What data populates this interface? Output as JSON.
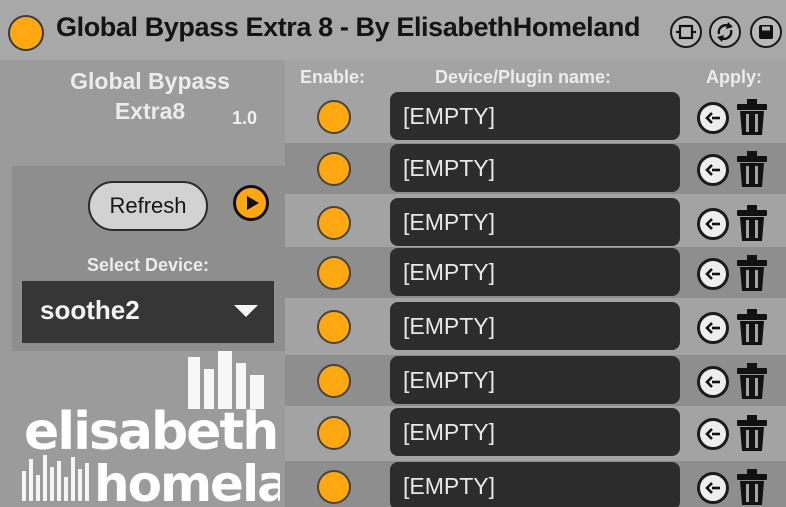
{
  "window": {
    "title": "Global Bypass Extra 8 - By ElisabethHomeland",
    "icons": [
      "pin-icon",
      "refresh-cycle-icon",
      "save-icon"
    ]
  },
  "left": {
    "title": "Global Bypass Extra8",
    "version": "1.0",
    "refresh_label": "Refresh",
    "select_label": "Select Device:",
    "selected_device": "soothe2",
    "logo_text": [
      "elisabeth",
      "homeland"
    ]
  },
  "headers": {
    "enable": "Enable:",
    "device_name": "Device/Plugin name:",
    "apply": "Apply:"
  },
  "rows": [
    {
      "enabled": true,
      "name": "[EMPTY]"
    },
    {
      "enabled": true,
      "name": "[EMPTY]"
    },
    {
      "enabled": true,
      "name": "[EMPTY]"
    },
    {
      "enabled": true,
      "name": "[EMPTY]"
    },
    {
      "enabled": true,
      "name": "[EMPTY]"
    },
    {
      "enabled": true,
      "name": "[EMPTY]"
    },
    {
      "enabled": true,
      "name": "[EMPTY]"
    },
    {
      "enabled": true,
      "name": "[EMPTY]"
    }
  ],
  "colors": {
    "accent": "#ffa812",
    "field_bg": "#2c2c2c",
    "panel_bg": "#a3a3a3",
    "row_dark": "#8e8e8e"
  }
}
